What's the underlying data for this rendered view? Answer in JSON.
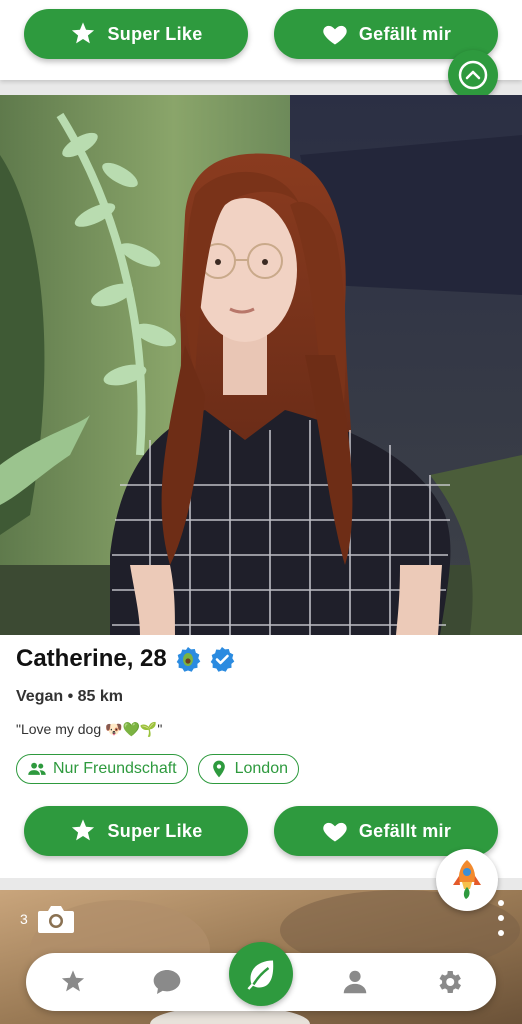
{
  "colors": {
    "brand_green": "#2e9a3e",
    "icon_gray": "#8a8a8a",
    "verified_blue": "#2b8be0"
  },
  "top_card": {
    "super_like_label": "Super Like",
    "like_label": "Gefällt mir"
  },
  "profile": {
    "name_age": "Catherine, 28",
    "meta": "Vegan • 85 km",
    "quote": "\"Love my dog 🐶💚🌱\"",
    "chips": [
      {
        "icon": "people-icon",
        "label": "Nur Freundschaft"
      },
      {
        "icon": "location-pin-icon",
        "label": "London"
      }
    ],
    "super_like_label": "Super Like",
    "like_label": "Gefällt mir",
    "badges": [
      "avocado-badge-icon",
      "verified-check-icon"
    ]
  },
  "next_card": {
    "photo_count": "3"
  },
  "bottom_nav": {
    "items": [
      "star-icon",
      "chat-icon",
      "leaf-icon",
      "person-icon",
      "gear-icon"
    ]
  }
}
